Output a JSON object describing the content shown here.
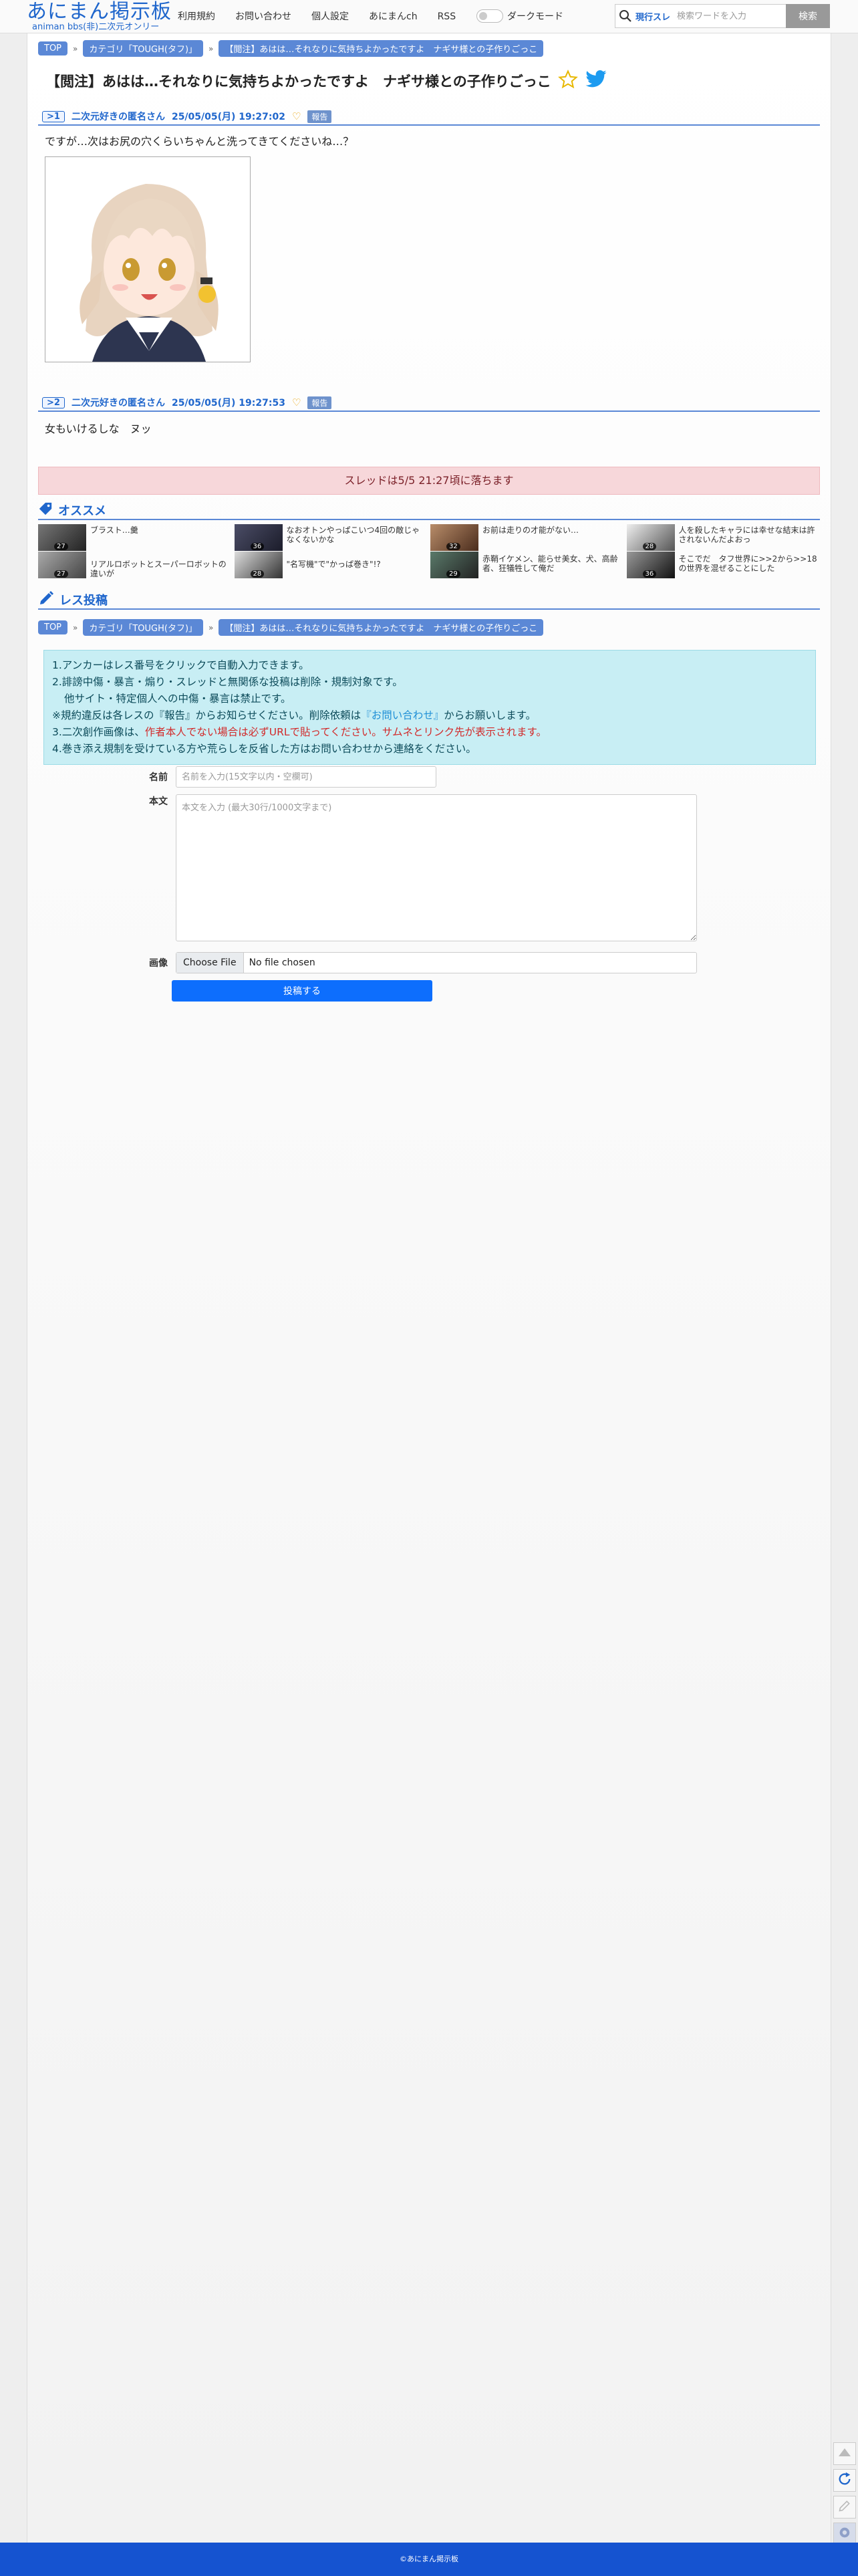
{
  "site": {
    "logo_main": "あにまん掲示板",
    "logo_sub": "animan bbs(非)二次元オンリー"
  },
  "nav": [
    "利用規約",
    "お問い合わせ",
    "個人設定",
    "あにまんch",
    "RSS"
  ],
  "dark_mode_label": "ダークモード",
  "search": {
    "scope": "現行スレ",
    "placeholder": "検索ワードを入力",
    "button": "検索"
  },
  "breadcrumbs": [
    "TOP",
    "カテゴリ「TOUGH(タフ)」",
    "【閲注】あはは…それなりに気持ちよかったですよ　ナギサ様との子作りごっこ"
  ],
  "thread_title": "【閲注】あはは…それなりに気持ちよかったですよ　ナギサ様との子作りごっこ",
  "posts": [
    {
      "num": ">1",
      "name": "二次元好きの匿名さん",
      "date": "25/05/05(月) 19:27:02",
      "report": "報告",
      "body": "ですが…次はお尻の穴くらいちゃんと洗ってきてくださいね…？"
    },
    {
      "num": ">2",
      "name": "二次元好きの匿名さん",
      "date": "25/05/05(月) 19:27:53",
      "report": "報告",
      "body": "女もいけるしな　ヌッ"
    }
  ],
  "expire_notice": "スレッドは5/5 21:27頃に落ちます",
  "recommend": {
    "heading": "オススメ",
    "columns": [
      [
        {
          "title": "ブラスト…羹",
          "count": "27"
        },
        {
          "title": "リアルロボットとスーパーロボットの違いが",
          "count": "27"
        }
      ],
      [
        {
          "title": "なおオトンやっぱこいつ4回の敵じゃなくないかな",
          "count": "36"
        },
        {
          "title": "\"名写機\"で\"かっぱ巻き\"!?",
          "count": "28"
        }
      ],
      [
        {
          "title": "お前は走りの才能がない…",
          "count": "32"
        },
        {
          "title": "赤鞘イケメン、能らせ美女、犬、高齢者、狂犠牲して俺だ",
          "count": "29"
        }
      ],
      [
        {
          "title": "人を殺したキャラには幸せな結末は許されないんだよおっ",
          "count": "28"
        },
        {
          "title": "そこでだ　タフ世界に>>2から>>18の世界を混ぜることにした",
          "count": "36"
        }
      ]
    ]
  },
  "reply": {
    "heading": "レス投稿",
    "rules": [
      "1.アンカーはレス番号をクリックで自動入力できます。",
      "2.誹謗中傷・暴言・煽り・スレッドと無関係な投稿は削除・規制対象です。",
      "他サイト・特定個人への中傷・暴言は禁止です。",
      "※規約違反は各レスの『報告』からお知らせください。削除依頼は",
      "『お問い合わせ』",
      "からお願いします。",
      "3.二次創作画像は、",
      "作者本人でない場合は必ずURLで貼ってください。サムネとリンク先が表示されます。",
      "4.巻き添え規制を受けている方や荒らしを反省した方はお問い合わせから連絡をください。"
    ],
    "name_label": "名前",
    "name_placeholder": "名前を入力(15文字以内・空欄可)",
    "body_label": "本文",
    "body_placeholder": "本文を入力 (最大30行/1000文字まで)",
    "image_label": "画像",
    "file_button": "Choose File",
    "file_value": "No file chosen",
    "submit": "投稿する"
  },
  "footer": "©あにまん掲示板",
  "colors": {
    "accent": "#1f66cc",
    "crumb_bg": "#5b88d6",
    "alert_bg": "#f7d7da",
    "info_bg": "#c8eef4",
    "footer_bg": "#1553d0",
    "submit_bg": "#0d6efd"
  },
  "icons": [
    "search-icon",
    "star-icon",
    "twitter-icon",
    "heart-icon",
    "tag-icon",
    "pencil-icon",
    "scroll-top-icon",
    "reload-icon",
    "edit-icon",
    "settings-icon"
  ]
}
